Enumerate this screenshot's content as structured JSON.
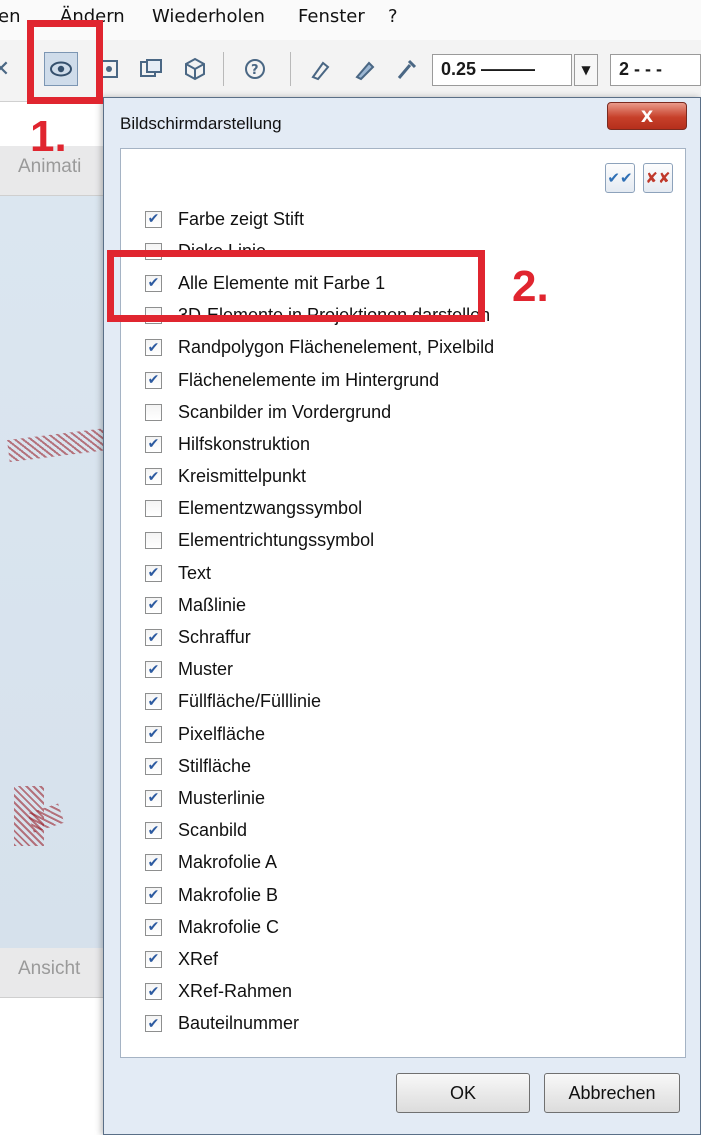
{
  "menubar": {
    "items": [
      {
        "label": "en"
      },
      {
        "label": "Ändern"
      },
      {
        "label": "Wiederholen"
      },
      {
        "label": "Fenster"
      },
      {
        "label": "?"
      }
    ]
  },
  "toolbar": {
    "pen_thickness": "0.25 ———",
    "line_type": "2 - - -"
  },
  "background": {
    "tab_top": "Animati",
    "tab_bottom": "Ansicht"
  },
  "dialog": {
    "title": "Bildschirmdarstellung",
    "close_glyph": "X",
    "ok_label": "OK",
    "cancel_label": "Abbrechen",
    "options": [
      {
        "label": "Farbe zeigt Stift",
        "checked": true
      },
      {
        "label": "Dicke Linie",
        "checked": false
      },
      {
        "label": "Alle Elemente mit Farbe 1",
        "checked": true
      },
      {
        "label": "3D-Elemente in Projektionen darstellen",
        "checked": false
      },
      {
        "label": "Randpolygon Flächenelement, Pixelbild",
        "checked": true
      },
      {
        "label": "Flächenelemente im Hintergrund",
        "checked": true
      },
      {
        "label": "Scanbilder im Vordergrund",
        "checked": false
      },
      {
        "label": "Hilfskonstruktion",
        "checked": true
      },
      {
        "label": "Kreismittelpunkt",
        "checked": true
      },
      {
        "label": "Elementzwangssymbol",
        "checked": false
      },
      {
        "label": "Elementrichtungssymbol",
        "checked": false
      },
      {
        "label": "Text",
        "checked": true
      },
      {
        "label": "Maßlinie",
        "checked": true
      },
      {
        "label": "Schraffur",
        "checked": true
      },
      {
        "label": "Muster",
        "checked": true
      },
      {
        "label": "Füllfläche/Fülllinie",
        "checked": true
      },
      {
        "label": "Pixelfläche",
        "checked": true
      },
      {
        "label": "Stilfläche",
        "checked": true
      },
      {
        "label": "Musterlinie",
        "checked": true
      },
      {
        "label": "Scanbild",
        "checked": true
      },
      {
        "label": "Makrofolie A",
        "checked": true
      },
      {
        "label": "Makrofolie B",
        "checked": true
      },
      {
        "label": "Makrofolie C",
        "checked": true
      },
      {
        "label": "XRef",
        "checked": true
      },
      {
        "label": "XRef-Rahmen",
        "checked": true
      },
      {
        "label": "Bauteilnummer",
        "checked": true
      }
    ]
  },
  "annotations": {
    "step1": "1.",
    "step2": "2.",
    "color": "#e0252f"
  },
  "colors": {
    "dialog_bg": "#e3ebf5",
    "checkmark": "#2c5aa0",
    "close_button": "#c7402a"
  },
  "icons": [
    "screen-display-icon",
    "preview-icon",
    "layer-icon",
    "cube-icon",
    "help-icon",
    "pen-icon",
    "brush-icon",
    "pipette-icon"
  ]
}
